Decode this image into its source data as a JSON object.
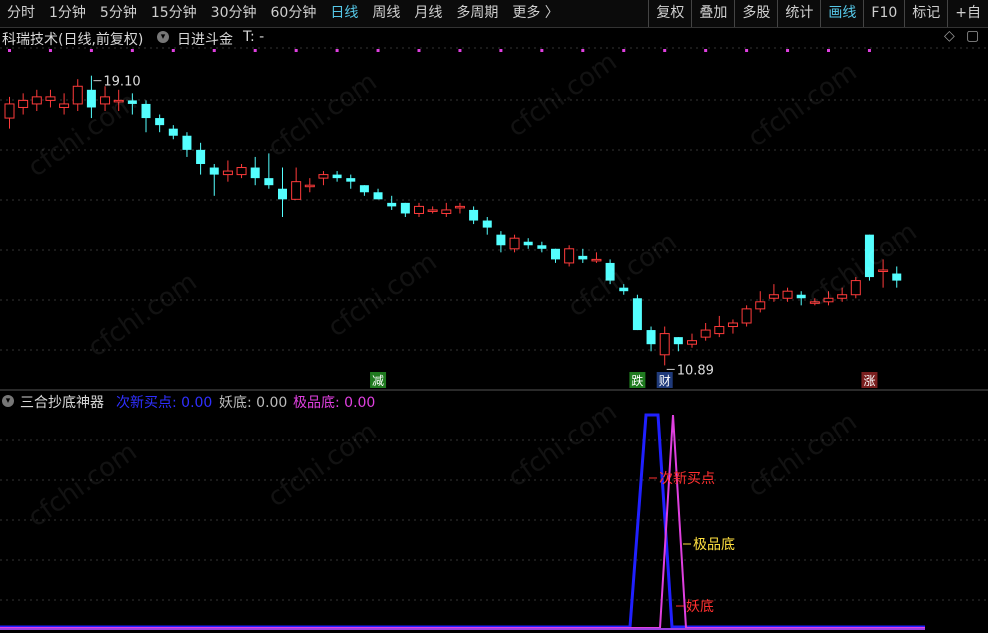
{
  "toolbar": {
    "periods": [
      "分时",
      "1分钟",
      "5分钟",
      "15分钟",
      "30分钟",
      "60分钟",
      "日线",
      "周线",
      "月线",
      "多周期",
      "更多 〉"
    ],
    "active_period": "日线",
    "tools": [
      "复权",
      "叠加",
      "多股",
      "统计",
      "画线",
      "F10",
      "标记",
      "+自"
    ],
    "active_tool": "画线"
  },
  "title_row": {
    "stock": "科瑞技术(日线,前复权)",
    "dropdown_icon": "chevron-down-icon",
    "indicator": "日进斗金",
    "t_value": "T: -"
  },
  "indicator_row": {
    "name": "三合抄底神器",
    "items": [
      {
        "label": "次新买点: 0.00",
        "color": "#2f2fff"
      },
      {
        "label": "妖底: 0.00",
        "color": "#bbbbbb"
      },
      {
        "label": "极品底: 0.00",
        "color": "#e040e0"
      }
    ]
  },
  "watermark": "cfchi.com",
  "chart_data": [
    {
      "type": "candlestick",
      "title": "科瑞技术(日线,前复权)",
      "up_color": "#ff3b3b",
      "down_color": "#54ffff",
      "annotations": [
        {
          "text": "19.10",
          "type": "high",
          "index": 6
        },
        {
          "text": "10.89",
          "type": "low",
          "index": 48
        }
      ],
      "event_tags": [
        {
          "text": "减",
          "index": 27,
          "bg": "#1f7a1f",
          "color": "#ffffff"
        },
        {
          "text": "跌",
          "index": 46,
          "bg": "#1f7a1f",
          "color": "#ffffff"
        },
        {
          "text": "财",
          "index": 48,
          "bg": "#1f3a7a",
          "color": "#ffffff"
        },
        {
          "text": "涨",
          "index": 63,
          "bg": "#7a1f1f",
          "color": "#ffffff"
        }
      ],
      "candles": [
        [
          17.9,
          18.3,
          18.5,
          17.6
        ],
        [
          18.2,
          18.4,
          18.6,
          18.0
        ],
        [
          18.3,
          18.5,
          18.7,
          18.1
        ],
        [
          18.4,
          18.5,
          18.7,
          18.2
        ],
        [
          18.2,
          18.3,
          18.6,
          18.0
        ],
        [
          18.3,
          18.8,
          19.0,
          18.1
        ],
        [
          18.7,
          18.2,
          19.1,
          17.9
        ],
        [
          18.3,
          18.5,
          18.8,
          18.1
        ],
        [
          18.4,
          18.4,
          18.7,
          18.1
        ],
        [
          18.4,
          18.3,
          18.6,
          18.0
        ],
        [
          18.3,
          17.9,
          18.4,
          17.5
        ],
        [
          17.9,
          17.7,
          18.0,
          17.5
        ],
        [
          17.6,
          17.4,
          17.7,
          17.3
        ],
        [
          17.4,
          17.0,
          17.5,
          16.8
        ],
        [
          17.0,
          16.6,
          17.2,
          16.3
        ],
        [
          16.5,
          16.3,
          16.6,
          15.7
        ],
        [
          16.3,
          16.4,
          16.7,
          16.1
        ],
        [
          16.3,
          16.5,
          16.6,
          16.2
        ],
        [
          16.5,
          16.2,
          16.8,
          16.0
        ],
        [
          16.2,
          16.0,
          16.9,
          15.9
        ],
        [
          15.9,
          15.6,
          16.5,
          15.1
        ],
        [
          15.6,
          16.1,
          16.5,
          15.6
        ],
        [
          16.0,
          16.0,
          16.2,
          15.8
        ],
        [
          16.2,
          16.3,
          16.4,
          16.0
        ],
        [
          16.3,
          16.2,
          16.4,
          16.1
        ],
        [
          16.2,
          16.1,
          16.3,
          15.9
        ],
        [
          16.0,
          15.8,
          16.0,
          15.7
        ],
        [
          15.8,
          15.6,
          15.9,
          15.6
        ],
        [
          15.5,
          15.4,
          15.7,
          15.3
        ],
        [
          15.5,
          15.2,
          15.5,
          15.1
        ],
        [
          15.2,
          15.4,
          15.5,
          15.1
        ],
        [
          15.3,
          15.3,
          15.4,
          15.2
        ],
        [
          15.2,
          15.3,
          15.5,
          15.1
        ],
        [
          15.4,
          15.4,
          15.5,
          15.2
        ],
        [
          15.3,
          15.0,
          15.4,
          14.9
        ],
        [
          15.0,
          14.8,
          15.1,
          14.6
        ],
        [
          14.6,
          14.3,
          14.7,
          14.1
        ],
        [
          14.2,
          14.5,
          14.6,
          14.1
        ],
        [
          14.4,
          14.3,
          14.5,
          14.2
        ],
        [
          14.3,
          14.2,
          14.4,
          14.1
        ],
        [
          14.2,
          13.9,
          14.2,
          13.8
        ],
        [
          13.8,
          14.2,
          14.3,
          13.7
        ],
        [
          14.0,
          13.9,
          14.2,
          13.8
        ],
        [
          13.9,
          13.9,
          14.1,
          13.8
        ],
        [
          13.8,
          13.3,
          13.9,
          13.2
        ],
        [
          13.1,
          13.0,
          13.2,
          12.9
        ],
        [
          12.8,
          11.9,
          12.9,
          11.9
        ],
        [
          11.9,
          11.5,
          12.0,
          11.3
        ],
        [
          11.2,
          11.8,
          12.0,
          10.9
        ],
        [
          11.7,
          11.5,
          11.7,
          11.3
        ],
        [
          11.5,
          11.6,
          11.8,
          11.4
        ],
        [
          11.7,
          11.9,
          12.1,
          11.6
        ],
        [
          11.8,
          12.0,
          12.3,
          11.7
        ],
        [
          12.0,
          12.1,
          12.2,
          11.8
        ],
        [
          12.1,
          12.5,
          12.6,
          12.0
        ],
        [
          12.5,
          12.7,
          13.0,
          12.4
        ],
        [
          12.8,
          12.9,
          13.2,
          12.7
        ],
        [
          12.8,
          13.0,
          13.1,
          12.7
        ],
        [
          12.9,
          12.8,
          13.0,
          12.6
        ],
        [
          12.7,
          12.7,
          12.8,
          12.6
        ],
        [
          12.7,
          12.8,
          13.0,
          12.6
        ],
        [
          12.8,
          12.9,
          13.1,
          12.7
        ],
        [
          12.9,
          13.3,
          13.4,
          12.8
        ],
        [
          14.6,
          13.4,
          14.6,
          13.3
        ],
        [
          13.6,
          13.6,
          13.9,
          13.1
        ],
        [
          13.5,
          13.3,
          13.7,
          13.1
        ]
      ]
    },
    {
      "type": "line",
      "title": "三合抄底神器",
      "series": [
        {
          "name": "次新买点",
          "color": "#2020ff"
        },
        {
          "name": "极品底",
          "color": "#e040e0"
        },
        {
          "name": "妖底",
          "color": "#bbbbbb"
        }
      ],
      "labels": [
        {
          "text": "次新买点",
          "color": "#ff3030"
        },
        {
          "text": "极品底",
          "color": "#ffe040"
        },
        {
          "text": "妖底",
          "color": "#ff3030"
        }
      ]
    }
  ]
}
